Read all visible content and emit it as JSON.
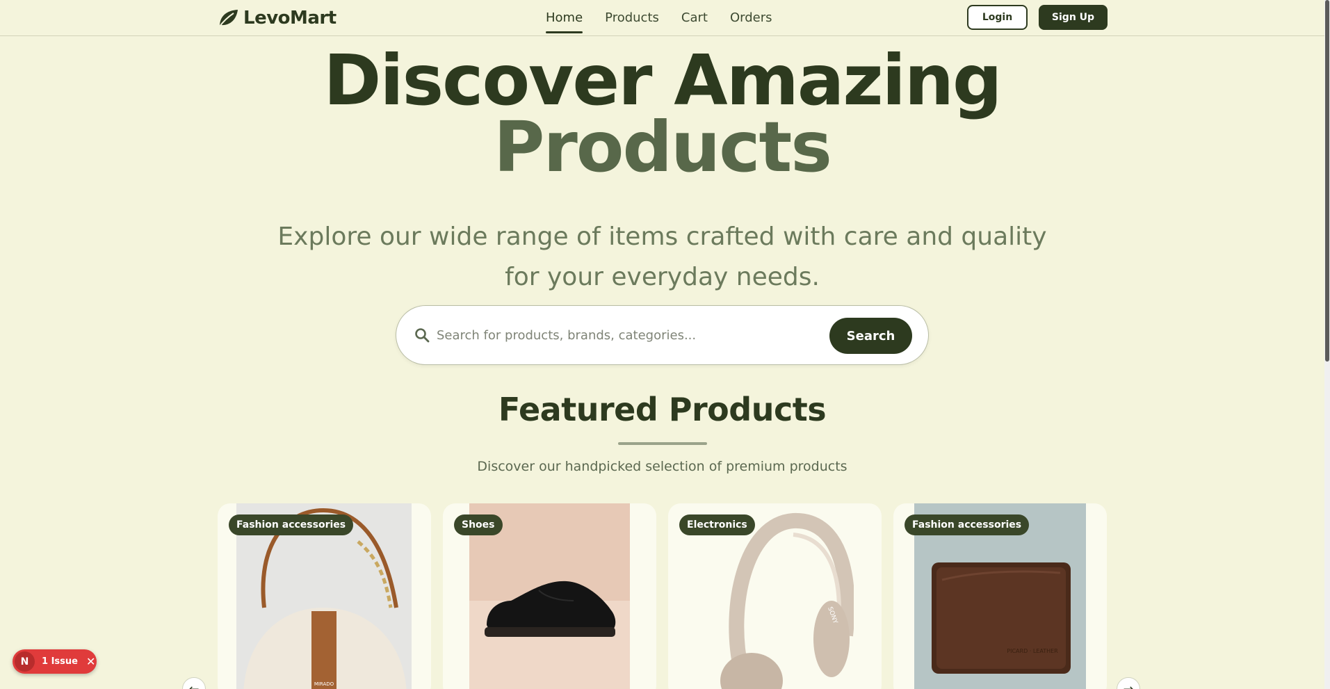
{
  "nav": {
    "brand": "LevoMart",
    "links": [
      "Home",
      "Products",
      "Cart",
      "Orders"
    ],
    "active": "Home",
    "login": "Login",
    "signup": "Sign Up"
  },
  "hero": {
    "title_line1": "Discover Amazing",
    "title_line2": "Products",
    "subtitle": "Explore our wide range of items crafted with care and quality for your everyday needs."
  },
  "search": {
    "placeholder": "Search for products, brands, categories...",
    "button": "Search"
  },
  "featured": {
    "title": "Featured Products",
    "subtitle": "Discover our handpicked selection of premium products",
    "cards": [
      {
        "category": "Fashion accessories",
        "image": "handbag"
      },
      {
        "category": "Shoes",
        "image": "sneaker"
      },
      {
        "category": "Electronics",
        "image": "headphones"
      },
      {
        "category": "Fashion accessories",
        "image": "wallet"
      }
    ]
  },
  "issues": {
    "badge": "N",
    "label": "1 Issue"
  },
  "colors": {
    "background": "#f4f4dc",
    "primary": "#2d3a1f",
    "accent": "#58684a",
    "issue": "#e03b3b"
  }
}
